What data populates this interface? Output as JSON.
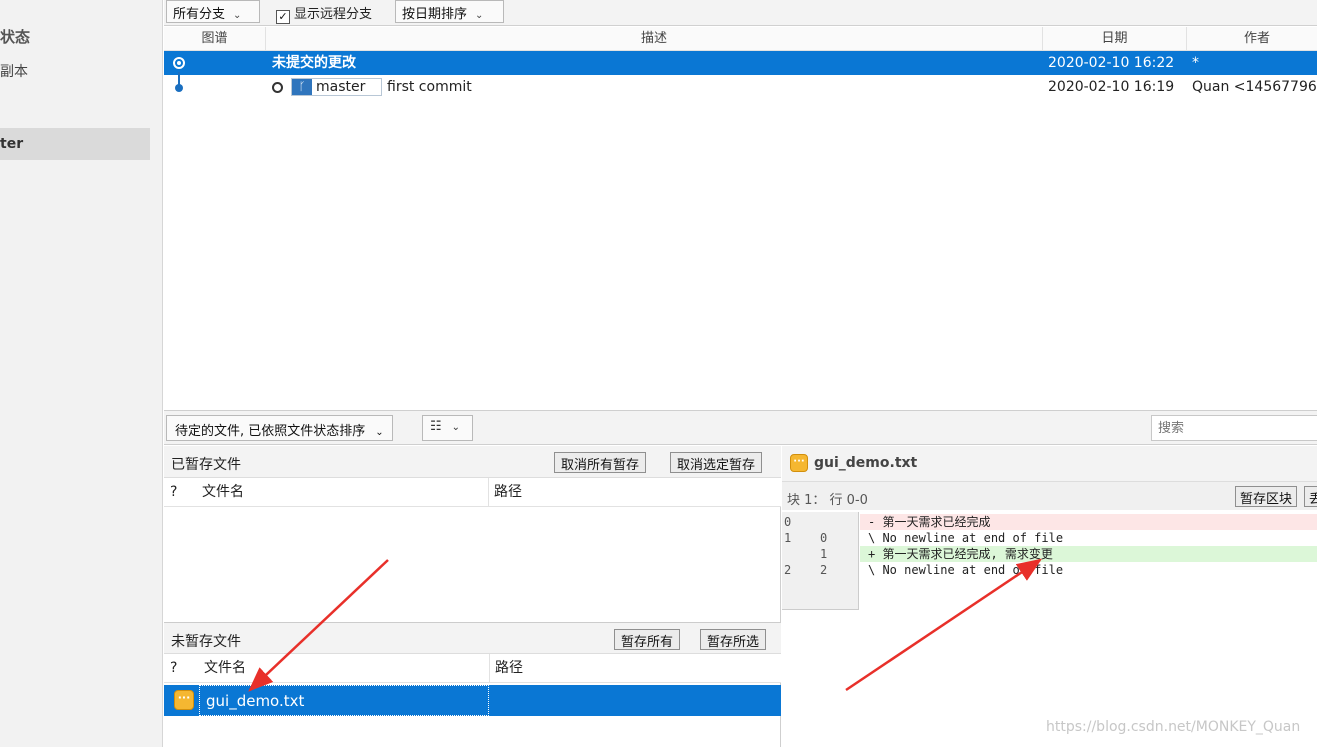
{
  "sidebar": {
    "status_label": "状态",
    "copy_label": "副本",
    "master_label": "ter"
  },
  "toolbar": {
    "branches_dropdown": "所有分支",
    "show_remote_label": "显示远程分支",
    "show_remote_checked": true,
    "sort_dropdown": "按日期排序"
  },
  "history": {
    "columns": [
      "图谱",
      "描述",
      "日期",
      "作者"
    ],
    "rows": [
      {
        "description": "未提交的更改",
        "date": "2020-02-10 16:22",
        "author": "*",
        "selected": true
      },
      {
        "branch": "master",
        "description": "first commit",
        "date": "2020-02-10 16:19",
        "author": "Quan <14567796",
        "selected": false
      }
    ]
  },
  "pending": {
    "dropdown_label": "待定的文件, 已依照文件状态排序",
    "view_icon": "list-view-icon",
    "search_placeholder": "搜索"
  },
  "staged": {
    "title": "已暂存文件",
    "unstage_all_label": "取消所有暂存",
    "unstage_selected_label": "取消选定暂存",
    "columns": [
      "?",
      "文件名",
      "路径"
    ]
  },
  "unstaged": {
    "title": "未暂存文件",
    "stage_all_label": "暂存所有",
    "stage_selected_label": "暂存所选",
    "columns": [
      "?",
      "文件名",
      "路径"
    ],
    "files": [
      {
        "name": "gui_demo.txt",
        "path": "",
        "status_icon": "modified-file-icon"
      }
    ]
  },
  "diff": {
    "file_name": "gui_demo.txt",
    "hunk_label": "块 1： 行 0-0",
    "stage_hunk_label": "暂存区块",
    "discard_hunk_label": "丢",
    "lines": [
      {
        "old": "0",
        "new": "",
        "text": "- 第一天需求已经完成",
        "kind": "del"
      },
      {
        "old": "1",
        "new": "0",
        "text": "\\  No newline at end of file",
        "kind": "ctx"
      },
      {
        "old": "",
        "new": "1",
        "text": "+ 第一天需求已经完成, 需求变更",
        "kind": "add"
      },
      {
        "old": "2",
        "new": "2",
        "text": "\\  No newline at end of file",
        "kind": "ctx"
      }
    ]
  },
  "watermark": "https://blog.csdn.net/MONKEY_Quan",
  "colors": {
    "selection": "#0a77d4",
    "annotation_arrow": "#e8302a"
  }
}
